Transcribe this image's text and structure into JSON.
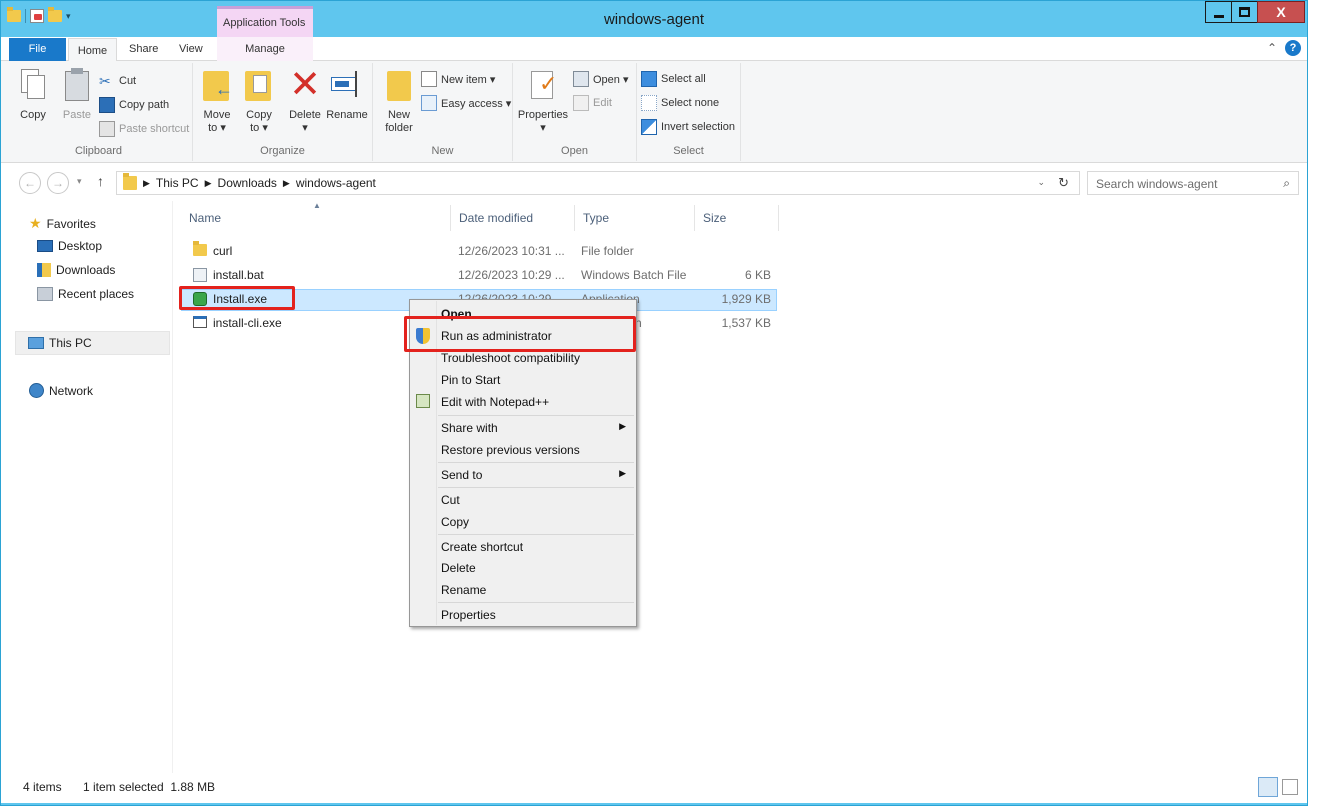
{
  "titlebar": {
    "title": "windows-agent",
    "context_tab_group": "Application Tools"
  },
  "ribbon_tabs": {
    "file": "File",
    "home": "Home",
    "share": "Share",
    "view": "View",
    "manage": "Manage"
  },
  "ribbon": {
    "clipboard": {
      "label": "Clipboard",
      "copy": "Copy",
      "paste": "Paste",
      "cut": "Cut",
      "copy_path": "Copy path",
      "paste_shortcut": "Paste shortcut"
    },
    "organize": {
      "label": "Organize",
      "move_to_1": "Move",
      "move_to_2": "to ▾",
      "copy_to_1": "Copy",
      "copy_to_2": "to ▾",
      "delete": "Delete",
      "delete_arrow": "▾",
      "rename": "Rename"
    },
    "new": {
      "label": "New",
      "new_folder_1": "New",
      "new_folder_2": "folder",
      "new_item": "New item ▾",
      "easy_access": "Easy access ▾"
    },
    "open": {
      "label": "Open",
      "properties": "Properties",
      "properties_arrow": "▾",
      "open": "Open ▾",
      "edit": "Edit"
    },
    "select": {
      "label": "Select",
      "select_all": "Select all",
      "select_none": "Select none",
      "invert_selection": "Invert selection"
    }
  },
  "address": {
    "crumbs": [
      "This PC",
      "Downloads",
      "windows-agent"
    ],
    "search_placeholder": "Search windows-agent"
  },
  "navpane": {
    "favorites": "Favorites",
    "desktop": "Desktop",
    "downloads": "Downloads",
    "recent_places": "Recent places",
    "this_pc": "This PC",
    "network": "Network"
  },
  "columns": {
    "name": "Name",
    "date_modified": "Date modified",
    "type": "Type",
    "size": "Size"
  },
  "files": [
    {
      "name": "curl",
      "date": "12/26/2023 10:31 ...",
      "type": "File folder",
      "size": ""
    },
    {
      "name": "install.bat",
      "date": "12/26/2023 10:29 ...",
      "type": "Windows Batch File",
      "size": "6 KB"
    },
    {
      "name": "Install.exe",
      "date": "12/26/2023 10:29 ...",
      "type": "Application",
      "size": "1,929 KB"
    },
    {
      "name": "install-cli.exe",
      "date": "",
      "type": "n",
      "size": "1,537 KB"
    }
  ],
  "context_menu": {
    "open": "Open",
    "run_as_admin": "Run as administrator",
    "troubleshoot": "Troubleshoot compatibility",
    "pin_to_start": "Pin to Start",
    "edit_notepad": "Edit with Notepad++",
    "share_with": "Share with",
    "restore_versions": "Restore previous versions",
    "send_to": "Send to",
    "cut": "Cut",
    "copy": "Copy",
    "create_shortcut": "Create shortcut",
    "delete": "Delete",
    "rename": "Rename",
    "properties": "Properties"
  },
  "status": {
    "item_count": "4 items",
    "selection": "1 item selected  1.88 MB"
  },
  "colors": {
    "titlebar": "#5fc6ee",
    "file_tab": "#1979ca",
    "selection": "#cce8ff",
    "highlight_box": "#e3221d"
  }
}
